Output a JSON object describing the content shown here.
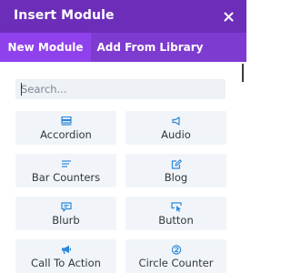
{
  "header": {
    "title": "Insert Module",
    "close_icon": "close-icon"
  },
  "tabs": [
    {
      "label": "New Module",
      "active": true
    },
    {
      "label": "Add From Library",
      "active": false
    }
  ],
  "search": {
    "placeholder": "Search...",
    "value": ""
  },
  "colors": {
    "header_bg": "#6c2eb9",
    "tabs_bg": "#7e3bd0",
    "active_tab_bg": "#8f42ec",
    "icon_blue": "#2b87da",
    "module_bg": "#f1f5f9"
  },
  "modules": [
    {
      "label": "Accordion",
      "icon": "accordion-icon"
    },
    {
      "label": "Audio",
      "icon": "audio-icon"
    },
    {
      "label": "Bar Counters",
      "icon": "bar-counters-icon"
    },
    {
      "label": "Blog",
      "icon": "blog-icon"
    },
    {
      "label": "Blurb",
      "icon": "blurb-icon"
    },
    {
      "label": "Button",
      "icon": "button-icon"
    },
    {
      "label": "Call To Action",
      "icon": "call-to-action-icon"
    },
    {
      "label": "Circle Counter",
      "icon": "circle-counter-icon"
    }
  ]
}
